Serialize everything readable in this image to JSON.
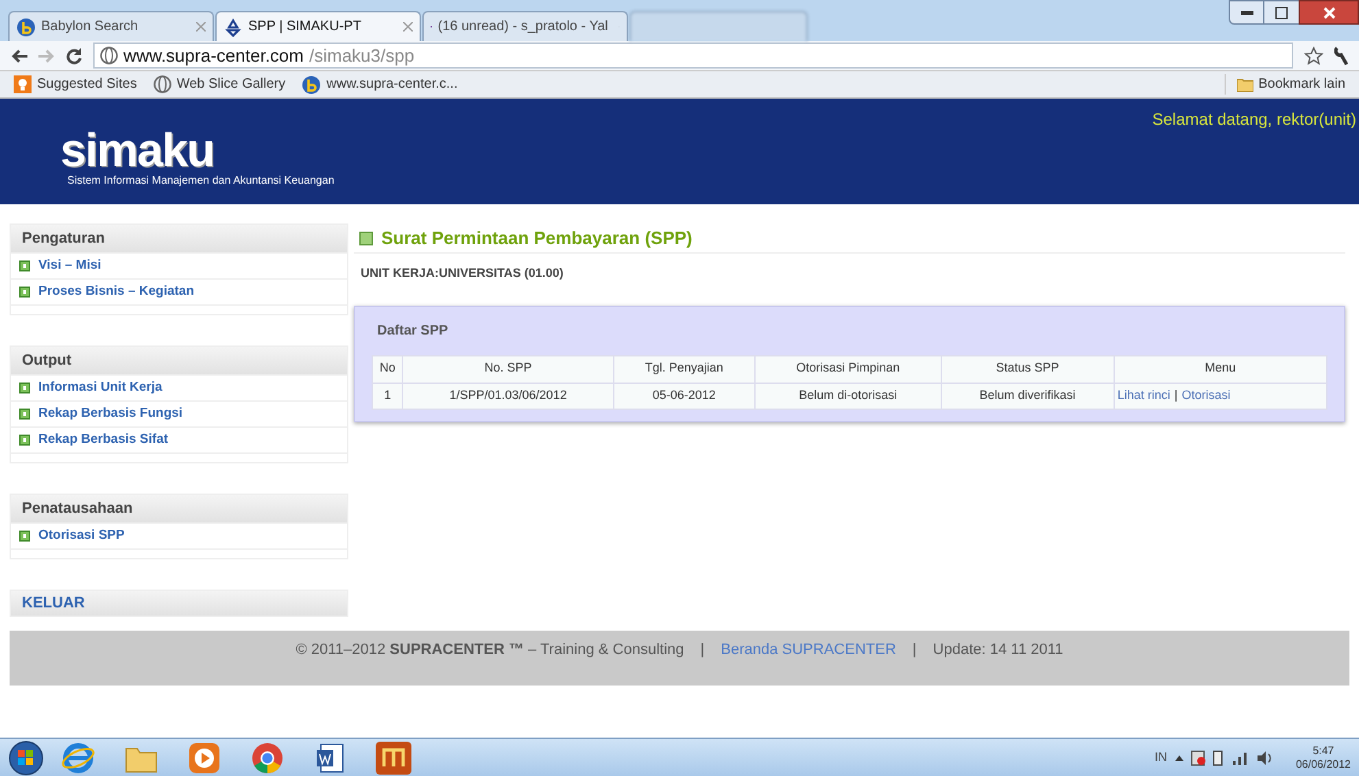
{
  "browser": {
    "tabs": [
      {
        "title": "Babylon Search",
        "selected": false
      },
      {
        "title": "SPP | SIMAKU-PT",
        "selected": true
      },
      {
        "title": "(16 unread) - s_pratolo - Yal",
        "selected": false
      }
    ],
    "url_host": "www.supra-center.com",
    "url_path": "/simaku3/spp",
    "bookmarks": [
      {
        "label": "Suggested Sites"
      },
      {
        "label": "Web Slice Gallery"
      },
      {
        "label": "www.supra-center.c..."
      }
    ],
    "other_bookmarks": "Bookmark lain"
  },
  "header": {
    "logo": "simaku",
    "tagline": "Sistem Informasi Manajemen dan Akuntansi Keuangan",
    "welcome": "Selamat datang, rektor(unit)"
  },
  "sidebar": [
    {
      "title": "Pengaturan",
      "kind": "menu",
      "items": [
        "Visi – Misi",
        "Proses Bisnis – Kegiatan"
      ]
    },
    {
      "title": "Output",
      "kind": "menu",
      "items": [
        "Informasi Unit Kerja",
        "Rekap Berbasis Fungsi",
        "Rekap Berbasis Sifat"
      ]
    },
    {
      "title": "Penatausahaan",
      "kind": "menu",
      "items": [
        "Otorisasi SPP"
      ]
    },
    {
      "title": "KELUAR",
      "kind": "link"
    }
  ],
  "main": {
    "title": "Surat Permintaan Pembayaran (SPP)",
    "unit": "UNIT KERJA:UNIVERSITAS (01.00)",
    "panel_title": "Daftar SPP",
    "table": {
      "columns": [
        "No",
        "No. SPP",
        "Tgl. Penyajian",
        "Otorisasi Pimpinan",
        "Status SPP",
        "Menu"
      ],
      "rows": [
        {
          "cells": [
            "1",
            "1/SPP/01.03/06/2012",
            "05-06-2012",
            "Belum di-otorisasi",
            "Belum diverifikasi"
          ],
          "links": [
            "Lihat rinci",
            "Otorisasi"
          ],
          "separator": "|"
        }
      ]
    }
  },
  "footer": {
    "copyright": "© 2011–2012 **SUPRACENTER ™** – Training & Consulting",
    "separator": "|",
    "link": "Beranda SUPRACENTER",
    "update": "Update: 14 11 2011"
  },
  "taskbar": {
    "language": "IN",
    "time": "5:47",
    "date": "06/06/2012"
  }
}
